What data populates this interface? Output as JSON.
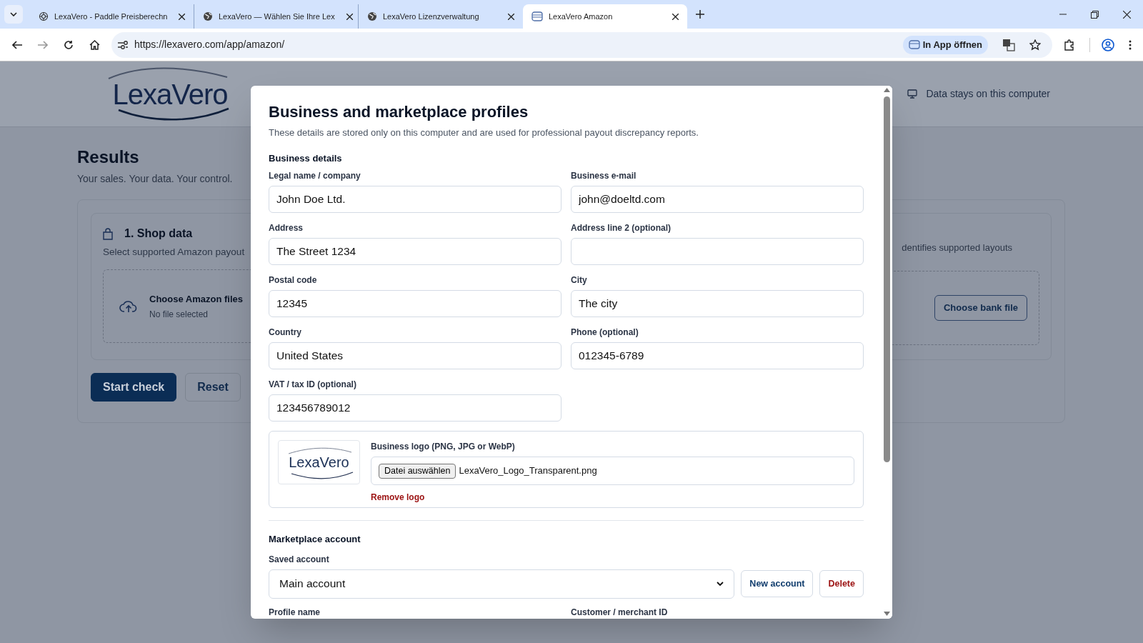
{
  "browser": {
    "tabs": [
      {
        "title": "LexaVero - Paddle Preisberechn",
        "kind": "knot",
        "selected": false
      },
      {
        "title": "LexaVero — Wählen Sie Ihre Lex",
        "kind": "globe",
        "selected": false
      },
      {
        "title": "LexaVero Lizenzverwaltung",
        "kind": "globe",
        "selected": false
      },
      {
        "title": "LexaVero Amazon",
        "kind": "app",
        "selected": true
      }
    ],
    "url": "https://lexavero.com/app/amazon/",
    "app_button": "In App öffnen"
  },
  "page": {
    "logo": "LexaVero",
    "header_note": "Data stays on this computer",
    "heading": "Results",
    "tagline": "Your sales. Your data. Your control.",
    "shop_card": {
      "title": "1. Shop data",
      "subtitle": "Select supported Amazon payout",
      "upload_title": "Choose Amazon files",
      "upload_status": "No file selected"
    },
    "bank_card": {
      "subtitle": "dentifies supported layouts",
      "button": "Choose bank file"
    },
    "actions": [
      {
        "label": "Start check",
        "kind": "primary"
      },
      {
        "label": "Reset",
        "kind": "secondary"
      }
    ]
  },
  "modal": {
    "title": "Business and marketplace profiles",
    "description": "These details are stored only on this computer and are used for professional payout discrepancy reports.",
    "business": {
      "heading": "Business details",
      "fields": [
        {
          "label": "Legal name / company",
          "value": "John Doe Ltd."
        },
        {
          "label": "Business e-mail",
          "value": "john@doeltd.com"
        },
        {
          "label": "Address",
          "value": "The Street 1234"
        },
        {
          "label": "Address line 2 (optional)"
        },
        {
          "label": "Postal code",
          "value": "12345"
        },
        {
          "label": "City",
          "value": "The city"
        },
        {
          "label": "Country",
          "value": "United States"
        },
        {
          "label": "Phone (optional)",
          "value": "012345-6789"
        },
        {
          "label": "VAT / tax ID (optional)",
          "value": "123456789012"
        }
      ]
    },
    "logo": {
      "preview": "LexaVero",
      "label": "Business logo (PNG, JPG or WebP)",
      "choose_button": "Datei auswählen",
      "file_name": "LexaVero_Logo_Transparent.png",
      "remove": "Remove logo"
    },
    "marketplace": {
      "heading": "Marketplace account",
      "saved_label": "Saved account",
      "selected_account": "Main account",
      "buttons": [
        {
          "label": "New account",
          "kind": "primary"
        },
        {
          "label": "Delete",
          "kind": "danger"
        }
      ],
      "fields": [
        {
          "label": "Profile name"
        },
        {
          "label": "Customer / merchant ID"
        }
      ]
    }
  }
}
